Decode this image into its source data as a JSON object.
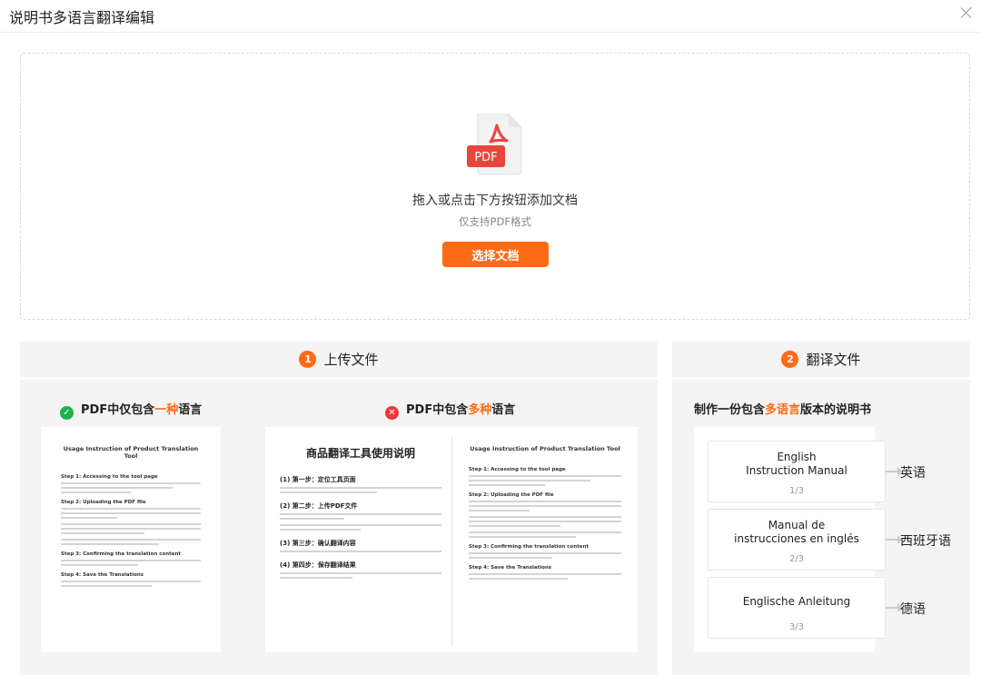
{
  "header": {
    "title": "说明书多语言翻译编辑"
  },
  "upload": {
    "icon_label": "PDF",
    "main_text": "拖入或点击下方按钮添加文档",
    "sub_text": "仅支持PDF格式",
    "button": "选择文档"
  },
  "step1": {
    "number": "1",
    "title": "上传文件",
    "ok_label_a": "PDF中仅包含",
    "ok_label_hl": "一种",
    "ok_label_b": "语言",
    "bad_label_a": "PDF中包含",
    "bad_label_hl": "多种",
    "bad_label_b": "语言"
  },
  "step2": {
    "number": "2",
    "title": "翻译文件",
    "desc_a": "制作一份包含",
    "desc_hl": "多语言",
    "desc_b": "版本的说明书"
  },
  "doc_en": {
    "title": "Usage Instruction of Product Translation Tool",
    "steps": [
      "Step 1:  Accessing to the tool page",
      "Step 2: Uploading the PDF file",
      "Step 3: Confirming the translation content",
      "Step 4: Save the Translations"
    ]
  },
  "doc_cn": {
    "title": "商品翻译工具使用说明",
    "steps": [
      "(1) 第一步：定位工具页面",
      "(2) 第二步：上传PDF文件",
      "(3) 第三步：确认翻译内容",
      "(4) 第四步：保存翻译结果"
    ]
  },
  "translations": [
    {
      "title": "English\nInstruction Manual",
      "count": "1/3",
      "lang": "英语"
    },
    {
      "title": "Manual de\ninstrucciones en inglés",
      "count": "2/3",
      "lang": "西班牙语"
    },
    {
      "title": "Englische Anleitung",
      "count": "3/3",
      "lang": "德语"
    }
  ],
  "colors": {
    "accent": "#ff6a14",
    "ok": "#1fb14c",
    "error": "#f0353a",
    "pdf_red": "#e8453c"
  }
}
